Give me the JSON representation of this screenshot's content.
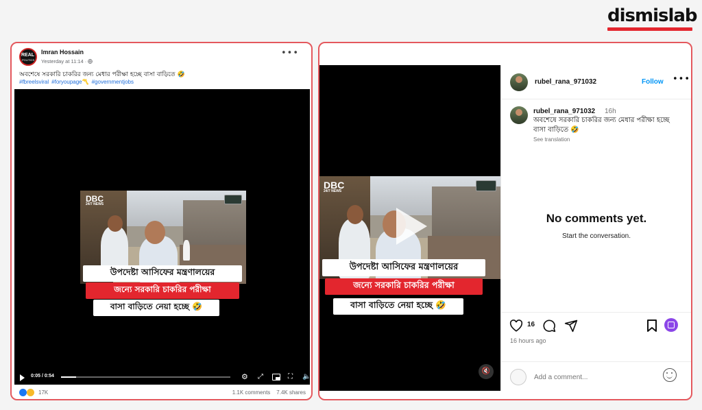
{
  "brand": {
    "name": "dismislab",
    "accent": "#e3262e"
  },
  "facebook": {
    "avatar_text": "REAL",
    "avatar_sub": "POLITICS",
    "author": "Imran Hossain",
    "timestamp": "Yesterday at 11:14 · ",
    "privacy_icon": "globe-icon",
    "caption": "অবশেষে সরকারি চাকরির জন্য মেধার পরীক্ষা  হচ্ছে বাসা বাড়িতে 🤣",
    "hashtags": [
      "#fbreelsviral",
      "#foryoupage〽️",
      "#governmentjobs"
    ],
    "video": {
      "channel_logo": "DBC",
      "channel_sub": "24/7 NEWS",
      "banner_line1": "উপদেষ্টা আসিফের মন্ত্রণালয়ের",
      "banner_line2": "জন্যে সরকারি চাকরির পরীক্ষা",
      "banner_line3": "বাসা বাড়িতে নেয়া হচ্ছে 🤣",
      "time": "0:05 / 0:54",
      "progress": 0.09
    },
    "reactions_count": "17K",
    "comments": "1.1K comments",
    "shares": "7.4K shares"
  },
  "instagram": {
    "username": "rubel_rana_971032",
    "follow_label": "Follow",
    "comment_author": "rubel_rana_971032",
    "comment_age": "16h",
    "caption": "অবশেষে সরকারি চাকরির জন্য মেধার পরীক্ষা  হচ্ছে বাসা বাড়িতে 🤣",
    "see_translation": "See translation",
    "empty_title": "No comments yet.",
    "empty_sub": "Start the conversation.",
    "likes": "16",
    "posted_ago": "16 hours ago",
    "comment_placeholder": "Add a comment...",
    "video": {
      "channel_logo": "DBC",
      "channel_sub": "24/7 NEWS",
      "banner_line1": "উপদেষ্টা আসিফের মন্ত্রণালয়ের",
      "banner_line2": "জন্যে সরকারি চাকরির পরীক্ষা",
      "banner_line3": "বাসা বাড়িতে নেয়া হচ্ছে 🤣"
    }
  }
}
